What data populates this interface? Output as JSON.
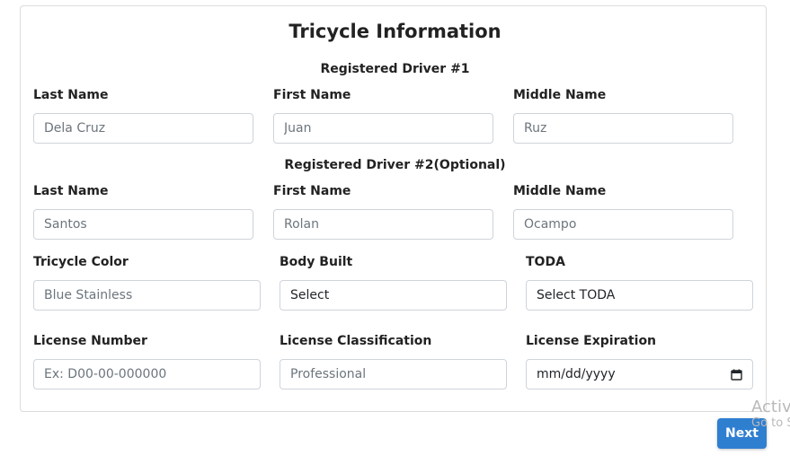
{
  "form": {
    "title": "Tricycle Information",
    "driver1_heading": "Registered Driver #1",
    "driver2_heading": "Registered Driver #2(Optional)",
    "labels": {
      "last_name": "Last Name",
      "first_name": "First Name",
      "middle_name": "Middle Name",
      "tricycle_color": "Tricycle Color",
      "body_built": "Body Built",
      "toda": "TODA",
      "license_number": "License Number",
      "license_classification": "License Classification",
      "license_expiration": "License Expiration"
    },
    "driver1": {
      "last_name_placeholder": "Dela Cruz",
      "first_name_placeholder": "Juan",
      "middle_name_placeholder": "Ruz"
    },
    "driver2": {
      "last_name_placeholder": "Santos",
      "first_name_placeholder": "Rolan",
      "middle_name_placeholder": "Ocampo"
    },
    "tricycle_color_placeholder": "Blue Stainless",
    "body_built_value": "Select",
    "toda_value": "Select TODA",
    "license_number_placeholder": "Ex: D00-00-000000",
    "license_classification_placeholder": "Professional",
    "license_expiration_placeholder": "mm/dd/yyyy"
  },
  "actions": {
    "next_label": "Next"
  },
  "watermark": {
    "line1": "Activ",
    "line2": "Go to S"
  },
  "icons": {
    "calendar": "calendar-icon"
  }
}
